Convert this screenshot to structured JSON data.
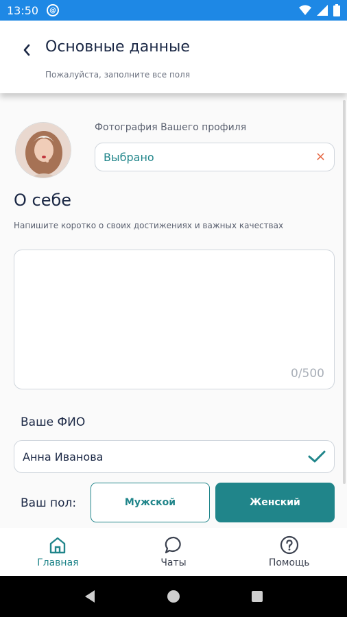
{
  "status_bar": {
    "time": "13:50"
  },
  "header": {
    "title": "Основные данные",
    "subtitle": "Пожалуйста, заполните все поля"
  },
  "photo": {
    "label": "Фотография Вашего профиля",
    "value": "Выбрано",
    "clear_icon": "×"
  },
  "about": {
    "title": "О себе",
    "hint": "Напишите коротко о своих достижениях и важных качествах",
    "counter": "0/500",
    "value": ""
  },
  "fio": {
    "label": "Ваше ФИО",
    "value": "Анна Иванова"
  },
  "gender": {
    "label": "Ваш пол:",
    "options": [
      "Мужской",
      "Женский"
    ],
    "selected": "Женский"
  },
  "bottom_nav": {
    "items": [
      {
        "label": "Главная",
        "icon": "home-icon",
        "active": true
      },
      {
        "label": "Чаты",
        "icon": "chat-icon",
        "active": false
      },
      {
        "label": "Помощь",
        "icon": "help-icon",
        "active": false
      }
    ]
  },
  "colors": {
    "accent": "#20858a",
    "status_bar": "#1e88e5",
    "clear": "#e5633e",
    "title": "#1a2744"
  }
}
